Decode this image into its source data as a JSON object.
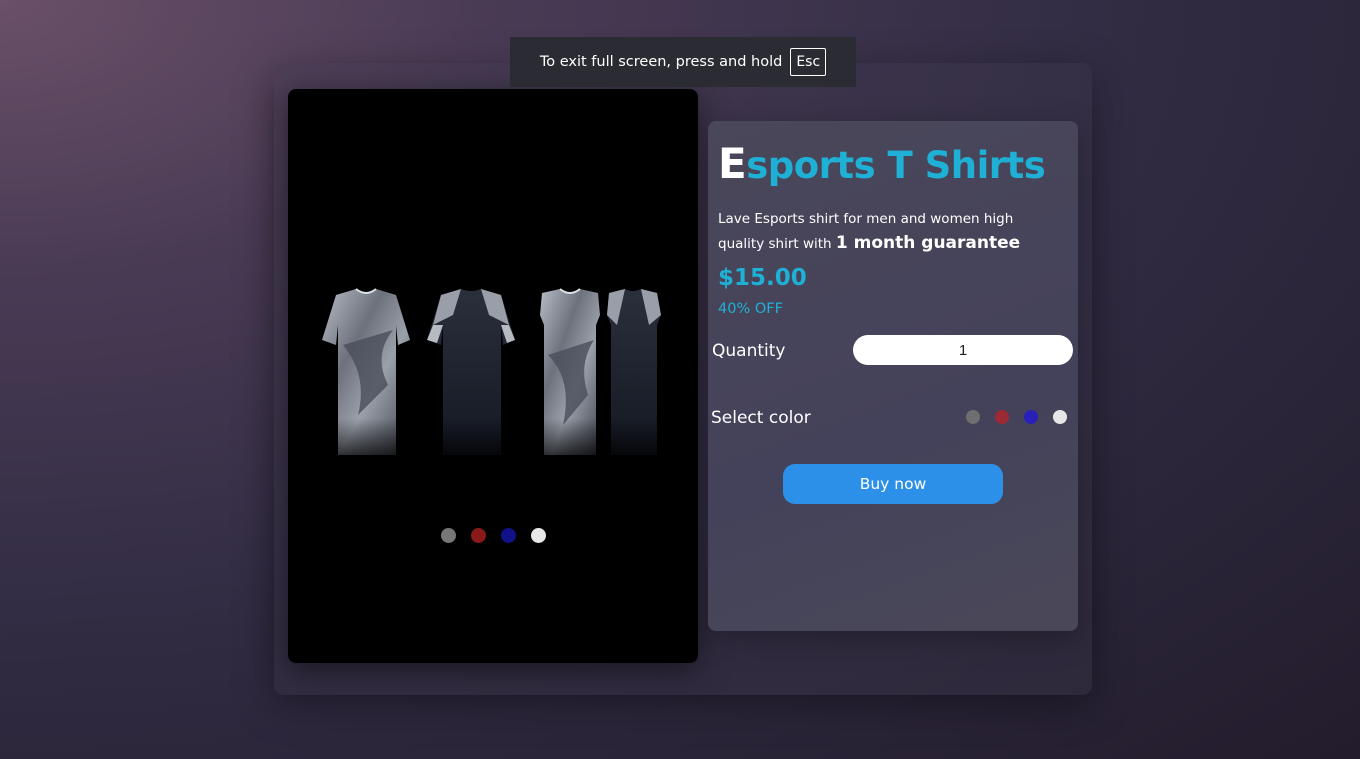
{
  "fullscreen_notice": {
    "text": "To exit full screen, press and hold",
    "key": "Esc"
  },
  "product": {
    "title_first_letter": "E",
    "title_rest": "sports T Shirts",
    "description": "Lave Esports shirt for men and women high quality shirt with ",
    "description_emphasis": "1 month guarantee",
    "price": "$15.00",
    "discount": "40% OFF"
  },
  "quantity": {
    "label": "Quantity",
    "value": "1"
  },
  "color_select": {
    "label": "Select color",
    "options": [
      {
        "name": "gray",
        "color": "#6f6f6f"
      },
      {
        "name": "red",
        "color": "#9c2a35"
      },
      {
        "name": "blue",
        "color": "#2a1fb8"
      },
      {
        "name": "white",
        "color": "#e6e6e6"
      }
    ]
  },
  "image_dots": [
    {
      "name": "gray",
      "color": "#777777"
    },
    {
      "name": "red",
      "color": "#8a1a1a"
    },
    {
      "name": "blue",
      "color": "#11118a"
    },
    {
      "name": "white",
      "color": "#e8e8e8"
    }
  ],
  "buy_button": {
    "label": "Buy now"
  },
  "colors": {
    "accent": "#1fb0d6",
    "button": "#2d90e8"
  }
}
